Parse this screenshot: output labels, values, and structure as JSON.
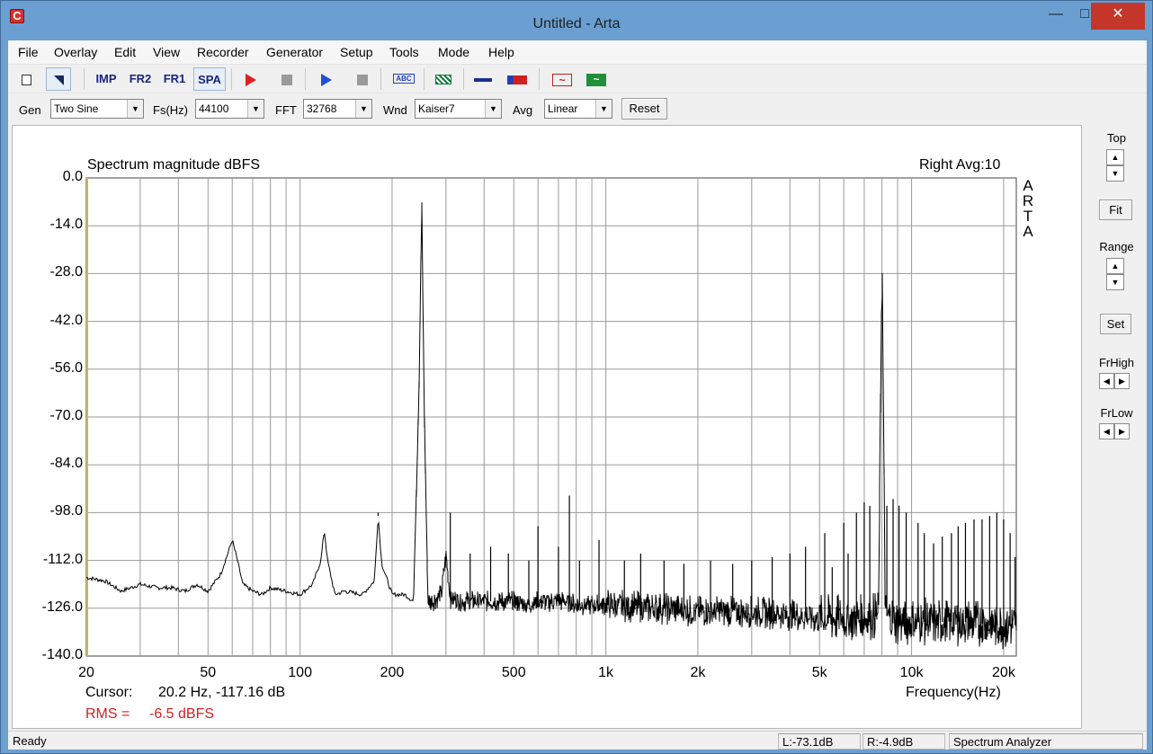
{
  "window": {
    "title": "Untitled - Arta"
  },
  "menu": [
    "File",
    "Overlay",
    "Edit",
    "View",
    "Recorder",
    "Generator",
    "Setup",
    "Tools",
    "Mode",
    "Help"
  ],
  "toolbar": {
    "imp": "IMP",
    "fr2": "FR2",
    "fr1": "FR1",
    "spa": "SPA",
    "abc": "ABC"
  },
  "controls": {
    "gen_label": "Gen",
    "gen_value": "Two Sine",
    "fs_label": "Fs(Hz)",
    "fs_value": "44100",
    "fft_label": "FFT",
    "fft_value": "32768",
    "wnd_label": "Wnd",
    "wnd_value": "Kaiser7",
    "avg_label": "Avg",
    "avg_value": "Linear",
    "reset_label": "Reset"
  },
  "plot": {
    "title": "Spectrum magnitude dBFS",
    "channel": "Right  Avg:10",
    "watermark": [
      "A",
      "R",
      "T",
      "A"
    ],
    "cursor_label": "Cursor:",
    "cursor_value": "20.2 Hz, -117.16 dB",
    "rms_label": "RMS =",
    "rms_value": "-6.5 dBFS",
    "xlabel": "Frequency(Hz)"
  },
  "side": {
    "top_label": "Top",
    "fit_label": "Fit",
    "range_label": "Range",
    "set_label": "Set",
    "frhigh_label": "FrHigh",
    "frlow_label": "FrLow"
  },
  "status": {
    "ready": "Ready",
    "left": "L:-73.1dB",
    "right": "R:-4.9dB",
    "mode": "Spectrum Analyzer"
  },
  "chart_data": {
    "type": "line",
    "title": "Spectrum magnitude dBFS",
    "xlabel": "Frequency(Hz)",
    "ylabel": "",
    "xscale": "log",
    "xlim": [
      20,
      22000
    ],
    "ylim": [
      -140,
      0
    ],
    "yticks": [
      "0.0",
      "-14.0",
      "-28.0",
      "-42.0",
      "-56.0",
      "-70.0",
      "-84.0",
      "-98.0",
      "-112.0",
      "-126.0",
      "-140.0"
    ],
    "xticks": [
      {
        "value": 20,
        "label": "20"
      },
      {
        "value": 50,
        "label": "50"
      },
      {
        "value": 100,
        "label": "100"
      },
      {
        "value": 200,
        "label": "200"
      },
      {
        "value": 500,
        "label": "500"
      },
      {
        "value": 1000,
        "label": "1k"
      },
      {
        "value": 2000,
        "label": "2k"
      },
      {
        "value": 5000,
        "label": "5k"
      },
      {
        "value": 10000,
        "label": "10k"
      },
      {
        "value": 20000,
        "label": "20k"
      }
    ],
    "grid": true,
    "series": [
      {
        "color": "#000000",
        "x": [
          20,
          23,
          26,
          30,
          34,
          38,
          42,
          46,
          50,
          55,
          58,
          60,
          62,
          65,
          70,
          75,
          80,
          90,
          100,
          110,
          117,
          120,
          123,
          130,
          140,
          160,
          175,
          180,
          185,
          200,
          220,
          235,
          245,
          250,
          255,
          262,
          270,
          290,
          300,
          310,
          340,
          360,
          400,
          450,
          500,
          560,
          600,
          700,
          750,
          800,
          900,
          1000,
          1500,
          2000,
          3000,
          4000,
          5000,
          6000,
          7000,
          7800,
          8000,
          8200,
          9000,
          10000,
          12000,
          15000,
          18000,
          20000,
          22000
        ],
        "y": [
          -117,
          -118,
          -121,
          -119,
          -120,
          -120,
          -121,
          -119,
          -121,
          -116,
          -110,
          -106,
          -111,
          -119,
          -121,
          -122,
          -120,
          -121,
          -122,
          -119,
          -112,
          -103,
          -112,
          -122,
          -121,
          -122,
          -118,
          -99,
          -113,
          -122,
          -122,
          -124,
          -60,
          -8,
          -70,
          -124,
          -124,
          -122,
          -110,
          -123,
          -124,
          -124,
          -124,
          -124,
          -124,
          -125,
          -124,
          -124,
          -124,
          -125,
          -125,
          -125,
          -126,
          -127,
          -127,
          -128,
          -129,
          -129,
          -129,
          -128,
          -20,
          -128,
          -130,
          -130,
          -130,
          -130,
          -131,
          -131,
          -131
        ]
      }
    ],
    "harmonics": [
      {
        "x": 180,
        "y": -98
      },
      {
        "x": 300,
        "y": -112
      },
      {
        "x": 310,
        "y": -98
      },
      {
        "x": 360,
        "y": -110
      },
      {
        "x": 420,
        "y": -108
      },
      {
        "x": 480,
        "y": -110
      },
      {
        "x": 560,
        "y": -112
      },
      {
        "x": 600,
        "y": -102
      },
      {
        "x": 700,
        "y": -108
      },
      {
        "x": 760,
        "y": -93
      },
      {
        "x": 820,
        "y": -112
      },
      {
        "x": 950,
        "y": -106
      },
      {
        "x": 1150,
        "y": -112
      },
      {
        "x": 1300,
        "y": -110
      },
      {
        "x": 1550,
        "y": -112
      },
      {
        "x": 1800,
        "y": -113
      },
      {
        "x": 2200,
        "y": -112
      },
      {
        "x": 2600,
        "y": -113
      },
      {
        "x": 3000,
        "y": -112
      },
      {
        "x": 3500,
        "y": -111
      },
      {
        "x": 4000,
        "y": -110
      },
      {
        "x": 4500,
        "y": -108
      },
      {
        "x": 5200,
        "y": -104
      },
      {
        "x": 5500,
        "y": -114
      },
      {
        "x": 6000,
        "y": -101
      },
      {
        "x": 6200,
        "y": -110
      },
      {
        "x": 6600,
        "y": -98
      },
      {
        "x": 7000,
        "y": -95
      },
      {
        "x": 7300,
        "y": -96
      },
      {
        "x": 8300,
        "y": -96
      },
      {
        "x": 8700,
        "y": -94
      },
      {
        "x": 9100,
        "y": -96
      },
      {
        "x": 9600,
        "y": -98
      },
      {
        "x": 10500,
        "y": -101
      },
      {
        "x": 11000,
        "y": -104
      },
      {
        "x": 11800,
        "y": -107
      },
      {
        "x": 12600,
        "y": -105
      },
      {
        "x": 13500,
        "y": -104
      },
      {
        "x": 14200,
        "y": -102
      },
      {
        "x": 15000,
        "y": -101
      },
      {
        "x": 16000,
        "y": -100
      },
      {
        "x": 17000,
        "y": -100
      },
      {
        "x": 18000,
        "y": -99
      },
      {
        "x": 19000,
        "y": -98
      },
      {
        "x": 20000,
        "y": -100
      },
      {
        "x": 21000,
        "y": -104
      },
      {
        "x": 21800,
        "y": -111
      }
    ]
  }
}
